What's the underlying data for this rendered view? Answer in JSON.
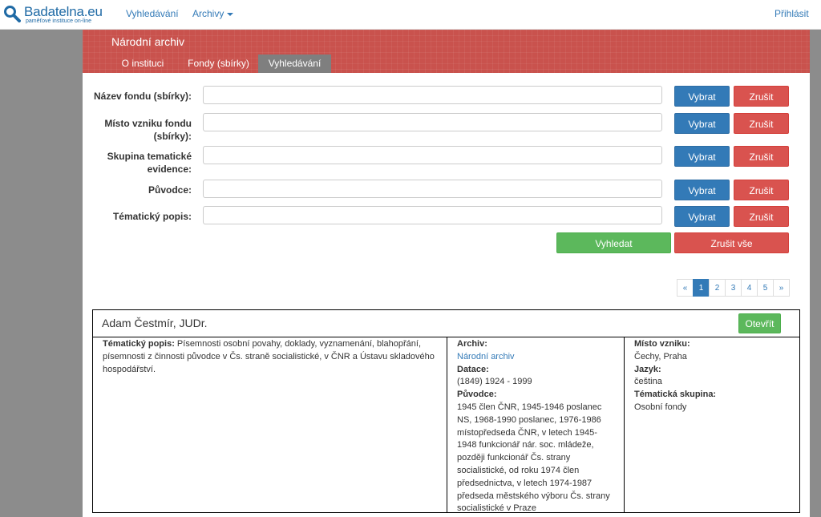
{
  "navbar": {
    "logo_name": "Badatelna.eu",
    "logo_tagline": "paměťové instituce on-line",
    "links": {
      "search": "Vyhledávání",
      "archives": "Archivy"
    },
    "login": "Přihlásit"
  },
  "institution": {
    "name": "Národní archiv",
    "tabs": [
      "O instituci",
      "Fondy (sbírky)",
      "Vyhledávání"
    ],
    "active_tab": "Vyhledávání"
  },
  "search_form": {
    "fields": [
      {
        "label": "Název fondu (sbírky):",
        "value": ""
      },
      {
        "label": "Místo vzniku fondu (sbírky):",
        "value": ""
      },
      {
        "label": "Skupina tematické evidence:",
        "value": ""
      },
      {
        "label": "Původce:",
        "value": ""
      },
      {
        "label": "Tématický popis:",
        "value": ""
      }
    ],
    "select_label": "Vybrat",
    "clear_label": "Zrušit",
    "search_button": "Vyhledat",
    "clear_all_button": "Zrušit vše"
  },
  "pagination": {
    "prev": "«",
    "pages": [
      "1",
      "2",
      "3",
      "4",
      "5"
    ],
    "next": "»",
    "current": "1"
  },
  "results": [
    {
      "title": "Adam Čestmír, JUDr.",
      "open_button": "Otevřít",
      "thematic_label": "Tématický popis:",
      "thematic_text": "Písemnosti osobní povahy, doklady, vyznamenání, blahopřání, písemnosti z činnosti původce v Čs. straně socialistické, v ČNR a Ústavu skladového hospodářství.",
      "archive_label": "Archiv:",
      "archive_value": "Národní archiv",
      "dating_label": "Datace:",
      "dating_value": "(1849) 1924 - 1999",
      "originator_label": "Původce:",
      "originator_value": "1945 člen ČNR, 1945-1946 poslanec NS, 1968-1990 poslanec, 1976-1986 místopředseda ČNR, v letech 1945-1948 funkcionář nár. soc. mládeže, později funkcionář Čs. strany socialistické, od roku 1974 člen předsednictva, v letech 1974-1987 předseda městského výboru Čs. strany socialistické v Praze",
      "place_label": "Místo vzniku:",
      "place_value": "Čechy, Praha",
      "language_label": "Jazyk:",
      "language_value": "čeština",
      "group_label": "Tématická skupina:",
      "group_value": "Osobní fondy"
    }
  ]
}
